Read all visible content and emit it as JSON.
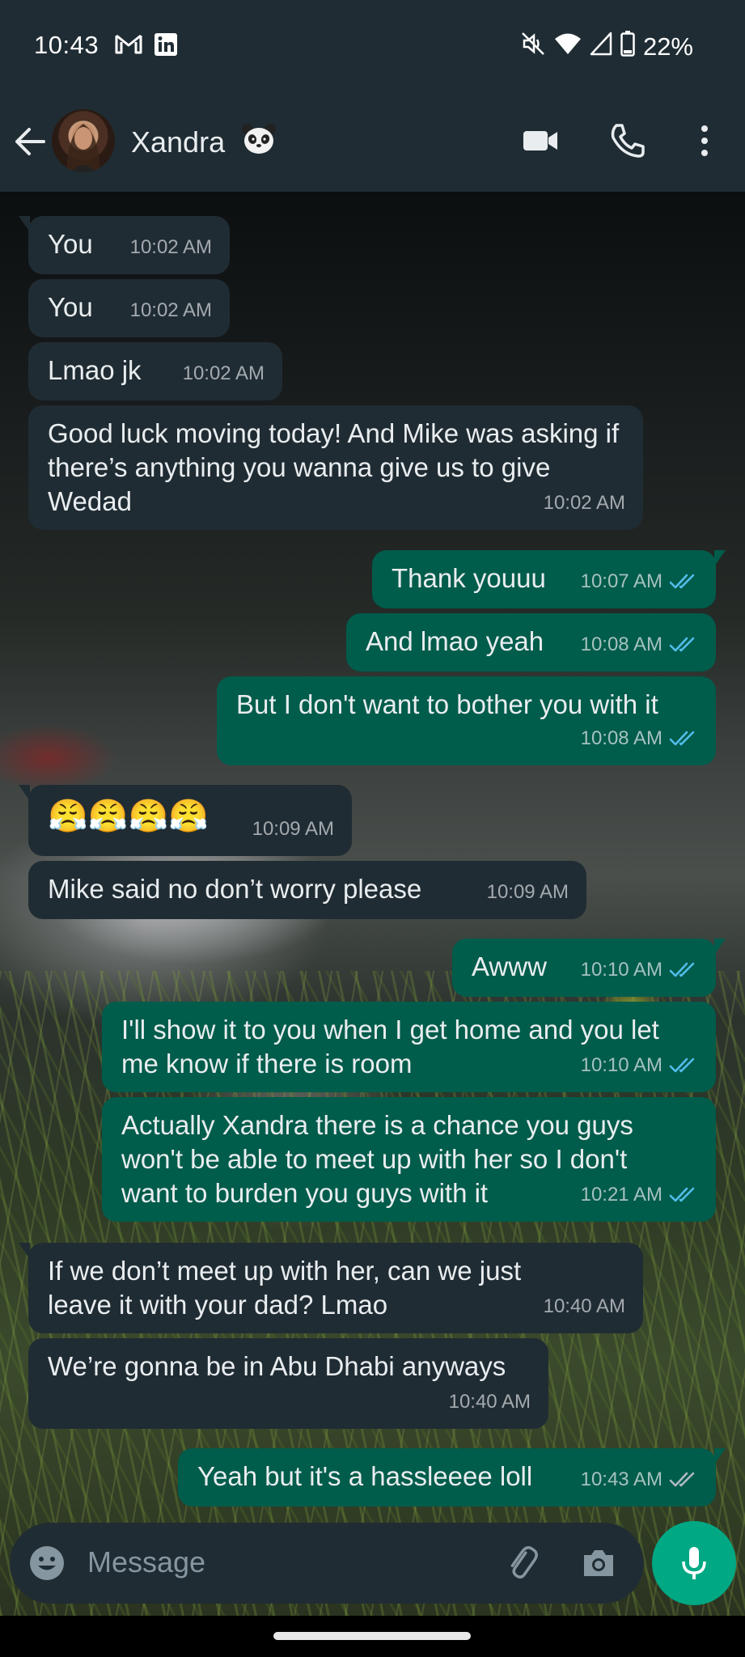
{
  "status_bar": {
    "time": "10:43",
    "battery": "22%",
    "left_icons": [
      "gmail-icon",
      "linkedin-icon"
    ],
    "right_icons": [
      "mute-icon",
      "wifi-icon",
      "signal-icon",
      "battery-icon"
    ]
  },
  "header": {
    "contact_name": "Xandra",
    "actions": [
      "video-call-icon",
      "phone-icon",
      "more-icon"
    ]
  },
  "messages": [
    {
      "dir": "in",
      "text": "You",
      "time": "10:02 AM"
    },
    {
      "dir": "in",
      "text": "You",
      "time": "10:02 AM"
    },
    {
      "dir": "in",
      "text": "Lmao jk",
      "time": "10:02 AM"
    },
    {
      "dir": "in",
      "text": "Good luck moving today! And Mike was asking if there’s anything you wanna give us to give Wedad",
      "time": "10:02 AM"
    },
    {
      "dir": "out",
      "text": "Thank youuu",
      "time": "10:07 AM",
      "status": "read"
    },
    {
      "dir": "out",
      "text": "And lmao yeah",
      "time": "10:08 AM",
      "status": "read"
    },
    {
      "dir": "out",
      "text": "But I don't want to bother you with it",
      "time": "10:08 AM",
      "status": "read"
    },
    {
      "dir": "in",
      "text": "😤😤😤😤",
      "time": "10:09 AM"
    },
    {
      "dir": "in",
      "text": "Mike said no don’t worry please",
      "time": "10:09 AM"
    },
    {
      "dir": "out",
      "text": "Awww",
      "time": "10:10 AM",
      "status": "read"
    },
    {
      "dir": "out",
      "text": "I'll show it to you when I get home and you let me know if there is room",
      "time": "10:10 AM",
      "status": "read"
    },
    {
      "dir": "out",
      "text": "Actually Xandra there is a chance you guys won't be able to meet up with her so I don't want to burden you guys with it",
      "time": "10:21 AM",
      "status": "read"
    },
    {
      "dir": "in",
      "text": "If we don’t meet up with her, can we just leave it with your dad? Lmao",
      "time": "10:40 AM"
    },
    {
      "dir": "in",
      "text": "We’re gonna be in Abu Dhabi anyways",
      "time": "10:40 AM"
    },
    {
      "dir": "out",
      "text": "Yeah but it's a hassleeee loll",
      "time": "10:43 AM",
      "status": "delivered"
    }
  ],
  "composer": {
    "placeholder": "Message"
  },
  "colors": {
    "header_bg": "#1f2c33",
    "incoming_bubble": "#202c33",
    "outgoing_bubble": "#005c4b",
    "read_ticks": "#53bdeb",
    "mic_button": "#00a884"
  }
}
